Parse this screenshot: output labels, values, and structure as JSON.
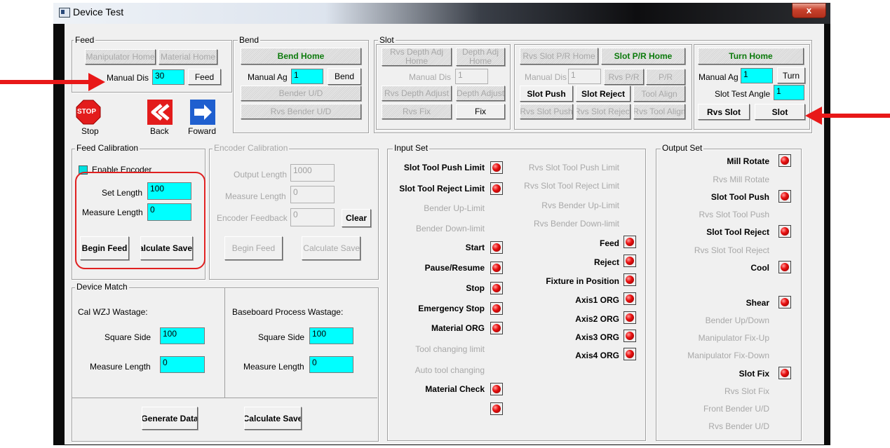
{
  "window": {
    "title": "Device Test",
    "close_label": "x"
  },
  "groups": {
    "feed": "Feed",
    "bend": "Bend",
    "slot": "Slot",
    "feed_cal": "Feed Calibration",
    "enc_cal": "Encoder Calibration",
    "input_set": "Input Set",
    "output_set": "Output Set",
    "device_match": "Device Match"
  },
  "feed": {
    "manip_home": "Manipulator Home",
    "material_home": "Material Home",
    "manual_dis_label": "Manual Dis",
    "manual_dis_value": "30",
    "feed_btn": "Feed",
    "stop": "Stop",
    "back": "Back",
    "forward": "Foward",
    "stop_sign": "STOP"
  },
  "bend": {
    "bend_home": "Bend Home",
    "manual_ag_label": "Manual Ag",
    "manual_ag_value": "1",
    "bend_btn": "Bend",
    "bender_ud": "Bender U/D",
    "rvs_bender_ud": "Rvs Bender U/D"
  },
  "slot": {
    "rvs_depth_adj_home": "Rvs Depth Adj Home",
    "depth_adj_home": "Depth Adj Home",
    "manual_dis_label": "Manual Dis",
    "manual_dis_value": "1",
    "rvs_depth_adjust": "Rvs Depth Adjust",
    "depth_adjust": "Depth Adjust",
    "rvs_fix": "Rvs Fix",
    "fix": "Fix",
    "rvs_slot_pr_home": "Rvs Slot P/R Home",
    "slot_pr_home": "Slot P/R Home",
    "manual_dis2_label": "Manual Dis",
    "manual_dis2_value": "1",
    "rvs_pr": "Rvs P/R",
    "pr": "P/R",
    "slot_push": "Slot Push",
    "slot_reject": "Slot Reject",
    "tool_align": "Tool Align",
    "rvs_slot_push": "Rvs Slot Push",
    "rvs_slot_reject": "Rvs Slot Reject",
    "rvs_tool_align": "Rvs Tool Align",
    "turn_home": "Turn Home",
    "manual_ag_label": "Manual Ag",
    "manual_ag_value": "1",
    "turn": "Turn",
    "slot_test_angle_label": "Slot Test Angle",
    "slot_test_angle_value": "1",
    "rvs_slot": "Rvs Slot",
    "slot_btn": "Slot"
  },
  "feed_cal": {
    "enable_encoder": "Enable Encoder",
    "set_length_label": "Set Length",
    "set_length_value": "100",
    "measure_length_label": "Measure Length",
    "measure_length_value": "0",
    "begin_feed": "Begin Feed",
    "calculate_save": "Calculate Save"
  },
  "enc_cal": {
    "output_length_label": "Output Length",
    "output_length_value": "1000",
    "measure_length_label": "Measure Length",
    "measure_length_value": "0",
    "encoder_feedback_label": "Encoder Feedback",
    "encoder_feedback_value": "0",
    "clear": "Clear",
    "begin_feed": "Begin Feed",
    "calculate_save": "Calculate Save"
  },
  "device_match": {
    "cal_wzj": "Cal WZJ Wastage:",
    "square_side_label": "Square Side",
    "square_side_value": "100",
    "measure_length_label": "Measure Length",
    "measure_length_value": "0",
    "baseboard": "Baseboard Process Wastage:",
    "square_side2_label": "Square Side",
    "square_side2_value": "100",
    "measure_length2_label": "Measure Length",
    "measure_length2_value": "0",
    "generate_data": "Generate Data",
    "calculate_save": "Calculate Save"
  },
  "input_set": {
    "left": [
      "Slot Tool Push Limit",
      "Slot Tool Reject Limit",
      "Bender Up-Limit",
      "Bender Down-limit",
      "Start",
      "Pause/Resume",
      "Stop",
      "Emergency Stop",
      "Material ORG",
      "Tool changing limit",
      "Auto tool changing",
      "Material Check",
      ""
    ],
    "right": [
      "Rvs Slot Tool Push Limit",
      "Rvs Slot Tool Reject Limit",
      "Rvs Bender Up-Limit",
      "Rvs Bender Down-limit",
      "Feed",
      "Reject",
      "Fixture in Position",
      "Axis1 ORG",
      "Axis2 ORG",
      "Axis3 ORG",
      "Axis4 ORG"
    ]
  },
  "output_set": {
    "items": [
      "Mill Rotate",
      "Rvs Mill Rotate",
      "Slot Tool Push",
      "Rvs Slot Tool Push",
      "Slot Tool Reject",
      "Rvs Slot Tool Reject",
      "Cool",
      "Shear",
      "Bender Up/Down",
      "Manipulator Fix-Up",
      "Manipulator Fix-Down",
      "Slot Fix",
      "Rvs Slot Fix",
      "Front Bender U/D",
      "Rvs Bender U/D"
    ]
  },
  "colors": {
    "input_bg": "#00ffff",
    "led": "#e81010",
    "annotation": "#e81818",
    "home_green": "#0b7a0b"
  }
}
